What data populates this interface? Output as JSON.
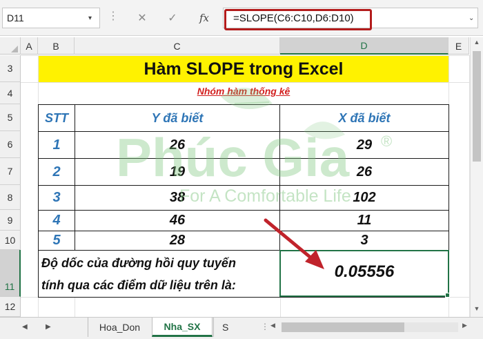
{
  "formula_bar": {
    "name_box": "D11",
    "name_box_arrow": "▾",
    "separator": "⋮",
    "cancel_glyph": "✕",
    "enter_glyph": "✓",
    "fx_label": "fx",
    "formula": "=SLOPE(C6:C10,D6:D10)",
    "chevron": "⌄",
    "highlight_color": "#b31b1b"
  },
  "columns": [
    "A",
    "B",
    "C",
    "D",
    "E"
  ],
  "selected_column": "D",
  "rows": [
    "3",
    "4",
    "5",
    "6",
    "7",
    "8",
    "9",
    "10",
    "11",
    "12"
  ],
  "selected_row": "11",
  "sheet": {
    "title": "Hàm SLOPE trong Excel",
    "title_fill": "#fff200",
    "subtitle": "Nhóm hàm thống kê",
    "headers": {
      "stt": "STT",
      "y": "Y đã biết",
      "x": "X đã biết"
    },
    "data_rows": [
      {
        "stt": "1",
        "y": "26",
        "x": "29"
      },
      {
        "stt": "2",
        "y": "19",
        "x": "26"
      },
      {
        "stt": "3",
        "y": "38",
        "x": "102"
      },
      {
        "stt": "4",
        "y": "46",
        "x": "11"
      },
      {
        "stt": "5",
        "y": "28",
        "x": "3"
      }
    ],
    "result_label_line1": "Độ dốc của đường hồi quy tuyến",
    "result_label_line2": "tính qua các điểm dữ liệu trên là:",
    "result_value": "0.05556"
  },
  "watermark": {
    "brand": "Phúc Gia",
    "registered": "®",
    "tagline": "For A Comfortable Life",
    "color": "#7cc47c"
  },
  "arrow": {
    "color": "#c0232b"
  },
  "tabs": {
    "nav_prev": "◀",
    "nav_next": "▶",
    "items": [
      "Hoa_Don",
      "Nha_SX",
      "S"
    ],
    "active": "Nha_SX",
    "separator": "⋮",
    "scroll_left": "◀",
    "scroll_right": "▶"
  },
  "vscroll": {
    "up": "▲",
    "down": "▼"
  },
  "accent_color": "#217346",
  "header_text_color": "#2e75b6"
}
